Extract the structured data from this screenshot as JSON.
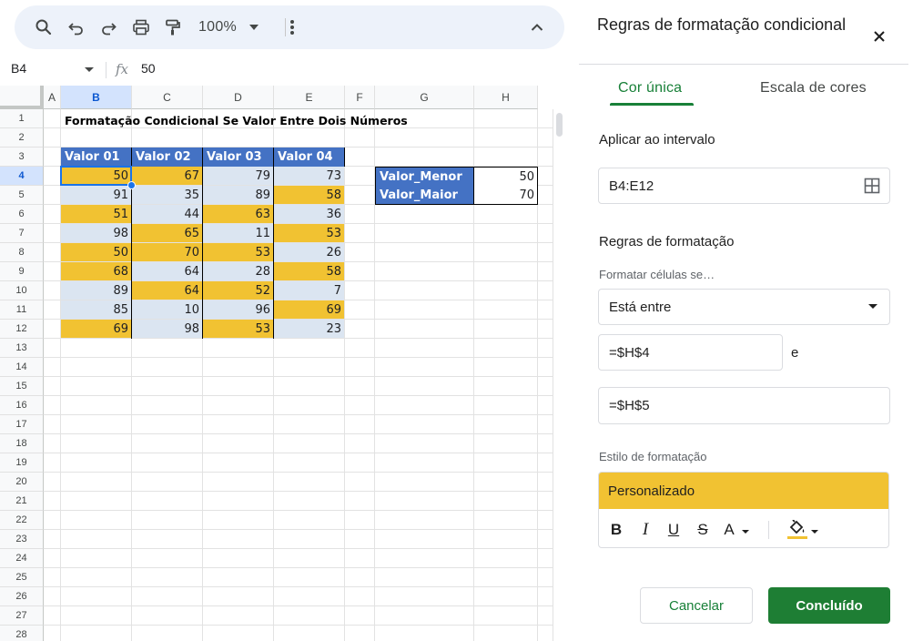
{
  "toolbar": {
    "zoom": "100%",
    "icons": [
      "search-icon",
      "undo-icon",
      "redo-icon",
      "print-icon",
      "paint-format-icon",
      "more-vert-icon",
      "chevron-up-icon"
    ]
  },
  "formula_bar": {
    "cell_ref": "B4",
    "fx": "fx",
    "value": "50"
  },
  "sheet": {
    "columns": [
      "A",
      "B",
      "C",
      "D",
      "E",
      "F",
      "G",
      "H"
    ],
    "rows": [
      "1",
      "2",
      "3",
      "4",
      "5",
      "6",
      "7",
      "8",
      "9",
      "10",
      "11",
      "12",
      "13",
      "14",
      "15",
      "16",
      "17",
      "18",
      "19",
      "20",
      "21",
      "22",
      "23",
      "24",
      "25",
      "26",
      "27",
      "28"
    ],
    "title": "Formatação Condicional Se Valor Entre Dois Números",
    "table_headers": [
      "Valor 01",
      "Valor 02",
      "Valor 03",
      "Valor 04"
    ],
    "table_rows": [
      [
        "50",
        "67",
        "79",
        "73"
      ],
      [
        "91",
        "35",
        "89",
        "58"
      ],
      [
        "51",
        "44",
        "63",
        "36"
      ],
      [
        "98",
        "65",
        "11",
        "53"
      ],
      [
        "50",
        "70",
        "53",
        "26"
      ],
      [
        "68",
        "64",
        "28",
        "58"
      ],
      [
        "89",
        "64",
        "52",
        "7"
      ],
      [
        "85",
        "10",
        "96",
        "69"
      ],
      [
        "69",
        "98",
        "53",
        "23"
      ]
    ],
    "highlight": [
      [
        true,
        true,
        false,
        false
      ],
      [
        false,
        false,
        false,
        true
      ],
      [
        true,
        false,
        true,
        false
      ],
      [
        false,
        true,
        false,
        true
      ],
      [
        true,
        true,
        true,
        false
      ],
      [
        true,
        false,
        false,
        true
      ],
      [
        false,
        true,
        true,
        false
      ],
      [
        false,
        false,
        false,
        true
      ],
      [
        true,
        false,
        true,
        false
      ]
    ],
    "bounds": {
      "min_label": "Valor_Menor",
      "min_value": "50",
      "max_label": "Valor_Maior",
      "max_value": "70"
    },
    "colors": {
      "highlight": "#f1c232",
      "normal": "#dbe5f1",
      "header": "#4472c4",
      "selection": "#1a73e8"
    }
  },
  "panel": {
    "title": "Regras de formatação condicional",
    "tabs": [
      "Cor única",
      "Escala de cores"
    ],
    "active_tab": "Cor única",
    "apply_range_label": "Aplicar ao intervalo",
    "range": "B4:E12",
    "rules_label": "Regras de formatação",
    "condition_label": "Formatar células se…",
    "condition": "Está entre",
    "value1": "=$H$4",
    "and_label": "e",
    "value2": "=$H$5",
    "style_label": "Estilo de formatação",
    "style_preview": "Personalizado",
    "format_buttons": [
      "B",
      "I",
      "U",
      "S",
      "A"
    ],
    "cancel_label": "Cancelar",
    "done_label": "Concluído",
    "accent": "#188038"
  }
}
